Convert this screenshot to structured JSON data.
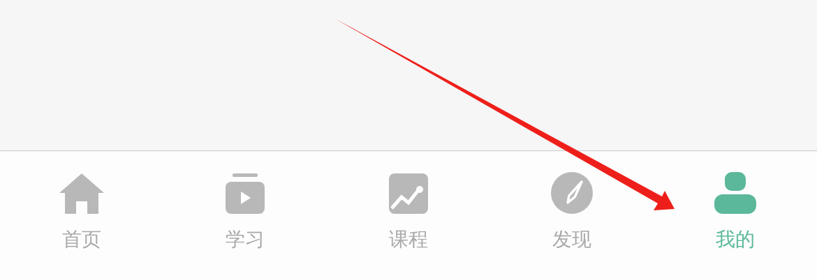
{
  "tabs": [
    {
      "label": "首页",
      "selected": false
    },
    {
      "label": "学习",
      "selected": false
    },
    {
      "label": "课程",
      "selected": false
    },
    {
      "label": "发现",
      "selected": false
    },
    {
      "label": "我的",
      "selected": true
    }
  ],
  "annotations": [
    {
      "kind": "arrow"
    }
  ]
}
